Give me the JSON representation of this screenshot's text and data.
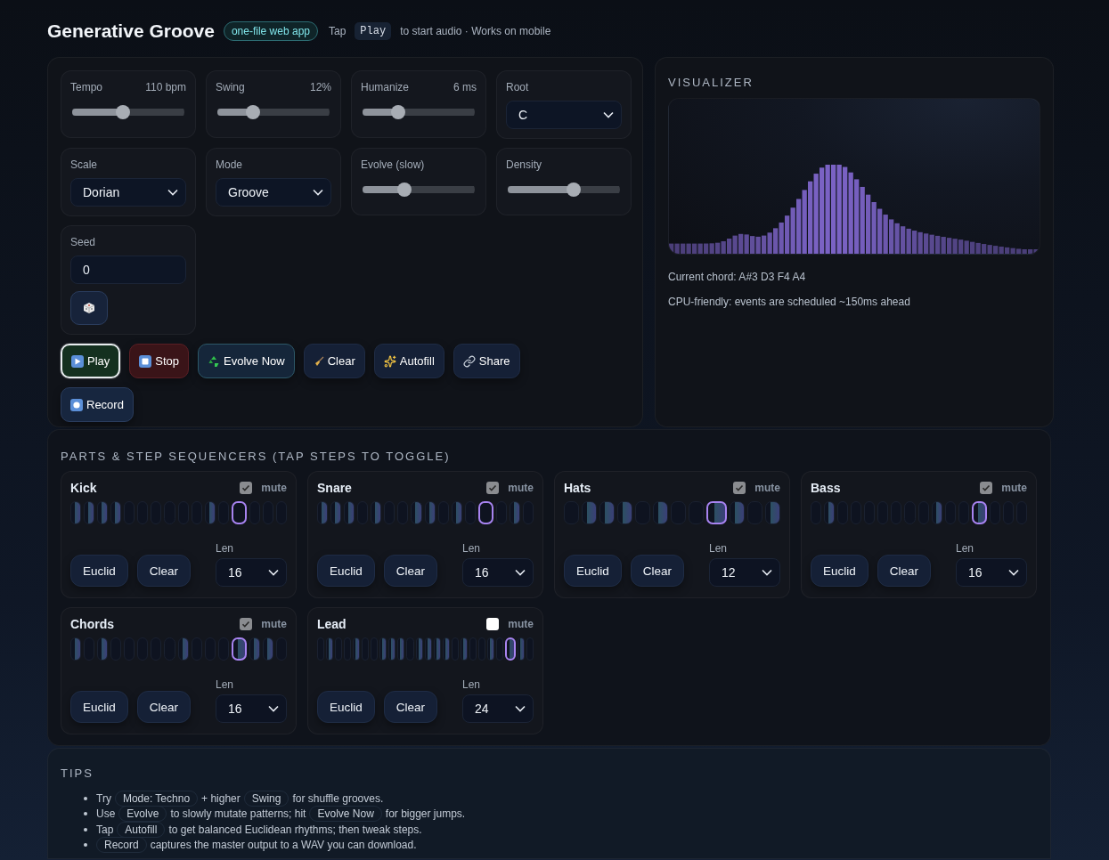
{
  "header": {
    "title": "Generative Groove",
    "badge": "one-file web app",
    "hint_before": "Tap",
    "hint_key": "Play",
    "hint_after": "to start audio · Works on mobile"
  },
  "controls": [
    {
      "kind": "slider",
      "label": "Tempo",
      "reading": "110 bpm",
      "level": 0.45
    },
    {
      "kind": "slider",
      "label": "Swing",
      "reading": "12%",
      "level": 0.32
    },
    {
      "kind": "slider",
      "label": "Humanize",
      "reading": "6 ms",
      "level": 0.32
    },
    {
      "kind": "select",
      "label": "Root",
      "value": "C"
    },
    {
      "kind": "select",
      "label": "Scale",
      "value": "Dorian"
    },
    {
      "kind": "select",
      "label": "Mode",
      "value": "Groove"
    },
    {
      "kind": "slider",
      "label": "Evolve (slow)",
      "level": 0.37
    },
    {
      "kind": "slider",
      "label": "Density",
      "level": 0.59
    },
    {
      "kind": "seed",
      "label": "Seed",
      "value": "0"
    }
  ],
  "buttons": [
    {
      "kind": "play",
      "label": "Play",
      "selected": true
    },
    {
      "kind": "stop",
      "label": "Stop",
      "selected": false
    },
    {
      "kind": "evolve",
      "label": "Evolve Now",
      "selected": false
    },
    {
      "kind": "clear",
      "label": "Clear",
      "selected": false
    },
    {
      "kind": "autofill",
      "label": "Autofill",
      "selected": false
    },
    {
      "kind": "share",
      "label": "Share",
      "selected": false
    },
    {
      "kind": "record",
      "label": "Record",
      "selected": false
    }
  ],
  "visualizer": {
    "title": "VISUALIZER",
    "chord": "Current chord: A#3 D3 F4 A4",
    "note": "CPU-friendly: events are scheduled ~150ms ahead"
  },
  "parts_title": "PARTS & STEP SEQUENCERS (TAP STEPS TO TOGGLE)",
  "parts": [
    {
      "name": "Kick",
      "mute_label": "mute",
      "muted": true,
      "euclid": "Euclid",
      "clear": "Clear",
      "len_label": "Len",
      "len": "16",
      "steps": [
        {
          "on": true,
          "playing": false
        },
        {
          "on": true,
          "playing": false
        },
        {
          "on": true,
          "playing": false
        },
        {
          "on": true,
          "playing": false
        },
        {
          "on": false,
          "playing": false
        },
        {
          "on": false,
          "playing": false
        },
        {
          "on": false,
          "playing": false
        },
        {
          "on": false,
          "playing": false
        },
        {
          "on": false,
          "playing": false
        },
        {
          "on": false,
          "playing": false
        },
        {
          "on": true,
          "playing": false
        },
        {
          "on": false,
          "playing": false
        },
        {
          "on": false,
          "playing": true
        },
        {
          "on": false,
          "playing": false
        },
        {
          "on": false,
          "playing": false
        },
        {
          "on": false,
          "playing": false
        }
      ]
    },
    {
      "name": "Snare",
      "mute_label": "mute",
      "muted": true,
      "euclid": "Euclid",
      "clear": "Clear",
      "len_label": "Len",
      "len": "16",
      "steps": [
        {
          "on": true,
          "playing": false
        },
        {
          "on": true,
          "playing": false
        },
        {
          "on": true,
          "playing": false
        },
        {
          "on": false,
          "playing": false
        },
        {
          "on": true,
          "playing": false
        },
        {
          "on": false,
          "playing": false
        },
        {
          "on": false,
          "playing": false
        },
        {
          "on": true,
          "playing": false
        },
        {
          "on": true,
          "playing": false
        },
        {
          "on": false,
          "playing": false
        },
        {
          "on": true,
          "playing": false
        },
        {
          "on": false,
          "playing": false
        },
        {
          "on": false,
          "playing": true
        },
        {
          "on": false,
          "playing": false
        },
        {
          "on": true,
          "playing": false
        },
        {
          "on": false,
          "playing": false
        }
      ]
    },
    {
      "name": "Hats",
      "mute_label": "mute",
      "muted": true,
      "euclid": "Euclid",
      "clear": "Clear",
      "len_label": "Len",
      "len": "12",
      "steps": [
        {
          "on": false,
          "playing": false
        },
        {
          "on": true,
          "playing": false
        },
        {
          "on": true,
          "playing": false
        },
        {
          "on": true,
          "playing": false
        },
        {
          "on": false,
          "playing": false
        },
        {
          "on": true,
          "playing": false
        },
        {
          "on": false,
          "playing": false
        },
        {
          "on": false,
          "playing": false
        },
        {
          "on": true,
          "playing": true
        },
        {
          "on": true,
          "playing": false
        },
        {
          "on": false,
          "playing": false
        },
        {
          "on": true,
          "playing": false
        }
      ]
    },
    {
      "name": "Bass",
      "mute_label": "mute",
      "muted": true,
      "euclid": "Euclid",
      "clear": "Clear",
      "len_label": "Len",
      "len": "16",
      "steps": [
        {
          "on": false,
          "playing": false
        },
        {
          "on": true,
          "playing": false
        },
        {
          "on": false,
          "playing": false
        },
        {
          "on": false,
          "playing": false
        },
        {
          "on": false,
          "playing": false
        },
        {
          "on": false,
          "playing": false
        },
        {
          "on": false,
          "playing": false
        },
        {
          "on": false,
          "playing": false
        },
        {
          "on": false,
          "playing": false
        },
        {
          "on": true,
          "playing": false
        },
        {
          "on": false,
          "playing": false
        },
        {
          "on": false,
          "playing": false
        },
        {
          "on": true,
          "playing": true
        },
        {
          "on": false,
          "playing": false
        },
        {
          "on": false,
          "playing": false
        },
        {
          "on": false,
          "playing": false
        }
      ]
    },
    {
      "name": "Chords",
      "mute_label": "mute",
      "muted": true,
      "euclid": "Euclid",
      "clear": "Clear",
      "len_label": "Len",
      "len": "16",
      "steps": [
        {
          "on": true,
          "playing": false
        },
        {
          "on": false,
          "playing": false
        },
        {
          "on": true,
          "playing": false
        },
        {
          "on": false,
          "playing": false
        },
        {
          "on": false,
          "playing": false
        },
        {
          "on": false,
          "playing": false
        },
        {
          "on": false,
          "playing": false
        },
        {
          "on": false,
          "playing": false
        },
        {
          "on": true,
          "playing": false
        },
        {
          "on": false,
          "playing": false
        },
        {
          "on": false,
          "playing": false
        },
        {
          "on": false,
          "playing": false
        },
        {
          "on": true,
          "playing": true
        },
        {
          "on": true,
          "playing": false
        },
        {
          "on": true,
          "playing": false
        },
        {
          "on": false,
          "playing": false
        }
      ]
    },
    {
      "name": "Lead",
      "mute_label": "mute",
      "muted": false,
      "euclid": "Euclid",
      "clear": "Clear",
      "len_label": "Len",
      "len": "24",
      "steps": [
        {
          "on": false,
          "playing": false
        },
        {
          "on": true,
          "playing": false
        },
        {
          "on": false,
          "playing": false
        },
        {
          "on": false,
          "playing": false
        },
        {
          "on": true,
          "playing": false
        },
        {
          "on": false,
          "playing": false
        },
        {
          "on": false,
          "playing": false
        },
        {
          "on": true,
          "playing": false
        },
        {
          "on": true,
          "playing": false
        },
        {
          "on": true,
          "playing": false
        },
        {
          "on": false,
          "playing": false
        },
        {
          "on": true,
          "playing": false
        },
        {
          "on": true,
          "playing": false
        },
        {
          "on": true,
          "playing": false
        },
        {
          "on": true,
          "playing": false
        },
        {
          "on": false,
          "playing": false
        },
        {
          "on": true,
          "playing": false
        },
        {
          "on": false,
          "playing": false
        },
        {
          "on": false,
          "playing": false
        },
        {
          "on": true,
          "playing": false
        },
        {
          "on": false,
          "playing": false
        },
        {
          "on": true,
          "playing": true
        },
        {
          "on": true,
          "playing": false
        },
        {
          "on": false,
          "playing": false
        }
      ]
    }
  ],
  "tips": {
    "title": "TIPS",
    "items": [
      [
        {
          "kind": "text",
          "text": "Try"
        },
        {
          "kind": "chip",
          "text": "Mode: Techno"
        },
        {
          "kind": "text",
          "text": "+ higher"
        },
        {
          "kind": "chip",
          "text": "Swing"
        },
        {
          "kind": "text",
          "text": "for shuffle grooves."
        }
      ],
      [
        {
          "kind": "text",
          "text": "Use"
        },
        {
          "kind": "chip",
          "text": "Evolve"
        },
        {
          "kind": "text",
          "text": "to slowly mutate patterns; hit"
        },
        {
          "kind": "chip",
          "text": "Evolve Now"
        },
        {
          "kind": "text",
          "text": "for bigger jumps."
        }
      ],
      [
        {
          "kind": "text",
          "text": "Tap"
        },
        {
          "kind": "chip",
          "text": "Autofill"
        },
        {
          "kind": "text",
          "text": "to get balanced Euclidean rhythms; then tweak steps."
        }
      ],
      [
        {
          "kind": "chip",
          "text": "Record"
        },
        {
          "kind": "text",
          "text": "captures the master output to a WAV you can download."
        }
      ]
    ]
  }
}
